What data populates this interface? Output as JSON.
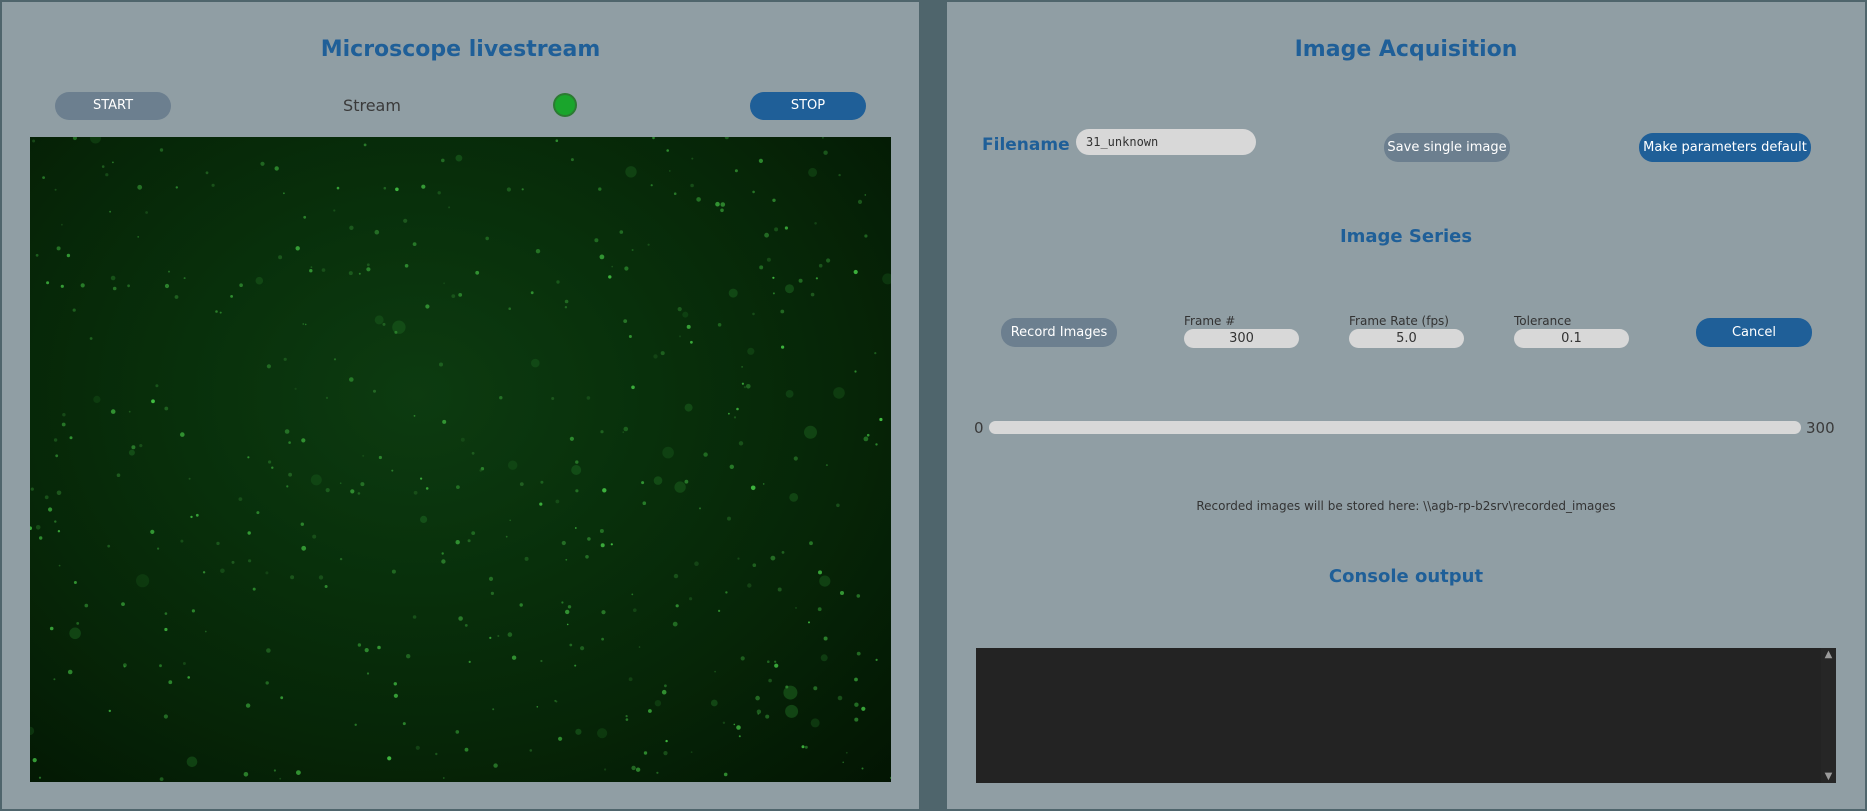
{
  "left_panel": {
    "title": "Microscope livestream",
    "start_label": "START",
    "stop_label": "STOP",
    "stream_label": "Stream",
    "stream_status_color": "#1aa52c"
  },
  "right_panel": {
    "title": "Image Acquisition",
    "filename_label": "Filename",
    "filename_value": "31_unknown",
    "save_single_label": "Save single image",
    "make_default_label": "Make parameters default",
    "series_title": "Image Series",
    "record_label": "Record Images",
    "frame_count_label": "Frame #",
    "frame_count_value": "300",
    "frame_rate_label": "Frame Rate (fps)",
    "frame_rate_value": "5.0",
    "tolerance_label": "Tolerance",
    "tolerance_value": "0.1",
    "cancel_label": "Cancel",
    "progress_min": "0",
    "progress_max": "300",
    "progress_value": 0,
    "storage_note": "Recorded images will be stored here: \\\\agb-rp-b2srv\\recorded_images",
    "console_title": "Console output",
    "console_text": ""
  },
  "colors": {
    "background": "#909ea4",
    "accent_blue": "#1f5f98",
    "button_grey": "#6c7f8f"
  }
}
